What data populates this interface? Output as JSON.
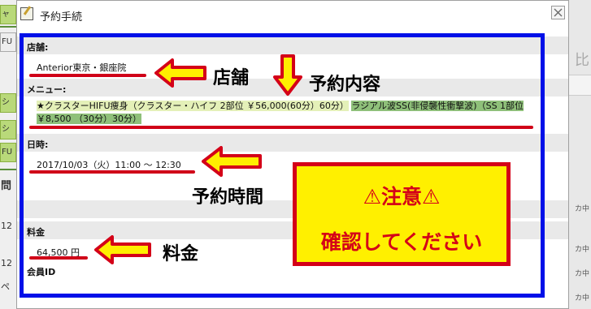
{
  "dialog": {
    "title": "予約手続",
    "close_glyph": "×"
  },
  "fields": {
    "store_label": "店舗:",
    "store_value": "Anterior東京・銀座院",
    "menu_label": "メニュー:",
    "menu_item_1": "★クラスターHIFU痩身（クラスター・ハイフ 2部位 ￥56,000(60分）60分）",
    "menu_item_2_a": "ラジアル波SS(非侵襲性衝撃波)（SS 1部位",
    "menu_item_2_b": "￥8,500 （30分）30分）",
    "datetime_label": "日時:",
    "datetime_value": "2017/10/03（火）11:00 ～ 12:30",
    "price_label": "料金",
    "price_value": "64,500 円",
    "member_label": "会員ID"
  },
  "annotations": {
    "store": "店舗",
    "contents": "予約内容",
    "time": "予約時間",
    "price": "料金",
    "notice_line1": "⚠注意⚠",
    "notice_line2": "確認してください"
  },
  "background": {
    "left_texts": [
      "ャ",
      "FU",
      "シ",
      "シ",
      "FU",
      "問",
      "12",
      "12",
      "ペ"
    ],
    "right_texts": [
      "比",
      "カ中",
      "カ中",
      "カ中",
      "カ中"
    ]
  },
  "colors": {
    "frame": "#0010e8",
    "accent_red": "#d40018",
    "notice_bg": "#fff000",
    "arrow_fill": "#ffef00"
  }
}
